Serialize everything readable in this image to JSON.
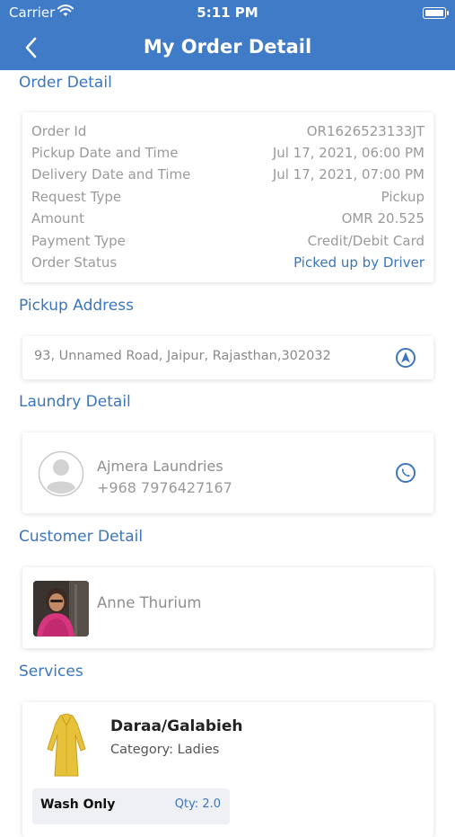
{
  "status_bar": {
    "carrier": "Carrier",
    "time": "5:11 PM"
  },
  "nav": {
    "title": "My Order Detail"
  },
  "order_detail": {
    "title": "Order Detail",
    "rows": [
      {
        "label": "Order Id",
        "value": "OR1626523133JT"
      },
      {
        "label": "Pickup Date and Time",
        "value": "Jul 17, 2021, 06:00 PM"
      },
      {
        "label": "Delivery Date and Time",
        "value": "Jul 17, 2021, 07:00 PM"
      },
      {
        "label": "Request Type",
        "value": "Pickup"
      },
      {
        "label": "Amount",
        "value": "OMR 20.525"
      },
      {
        "label": "Payment Type",
        "value": "Credit/Debit Card"
      },
      {
        "label": "Order Status",
        "value": "Picked up by Driver"
      }
    ]
  },
  "pickup_address": {
    "title": "Pickup Address",
    "address": "93, Unnamed Road, Jaipur, Rajasthan,302032"
  },
  "laundry_detail": {
    "title": "Laundry Detail",
    "name": "Ajmera Laundries",
    "phone": "+968 7976427167"
  },
  "customer_detail": {
    "title": "Customer Detail",
    "name": "Anne Thurium"
  },
  "services": {
    "title": "Services",
    "items": [
      {
        "name": "Daraa/Galabieh",
        "category": "Category: Ladies",
        "wash_label": "Wash Only",
        "qty": "Qty: 2.0"
      }
    ]
  },
  "colors": {
    "brand_blue": "#3f7bc6",
    "status_blue": "#3b76bd",
    "label_gray": "#9a9a9a"
  },
  "icons": {
    "back": "chevron-left-icon",
    "wifi": "wifi-icon",
    "battery": "battery-icon",
    "navigate": "navigation-arrow-icon",
    "phone": "phone-icon",
    "avatar": "user-placeholder-icon"
  }
}
